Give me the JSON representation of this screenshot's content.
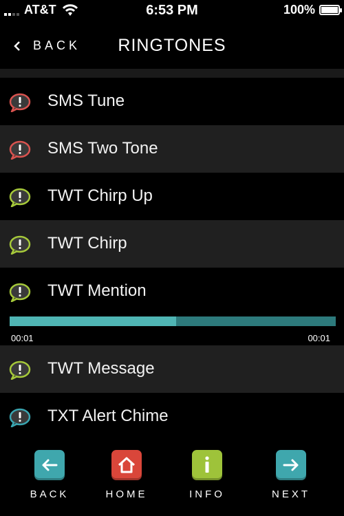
{
  "status_bar": {
    "carrier": "AT&T",
    "time": "6:53 PM",
    "battery": "100%"
  },
  "nav": {
    "back_label": "BACK",
    "title": "RINGTONES"
  },
  "ringtones": [
    {
      "label": "SMS Tune",
      "icon": "alert-bubble-icon",
      "color": "#d9534f"
    },
    {
      "label": "SMS Two Tone",
      "icon": "alert-bubble-icon",
      "color": "#d9534f"
    },
    {
      "label": "TWT Chirp Up",
      "icon": "alert-bubble-icon",
      "color": "#a6c93a"
    },
    {
      "label": "TWT Chirp",
      "icon": "alert-bubble-icon",
      "color": "#a6c93a"
    },
    {
      "label": "TWT Mention",
      "icon": "alert-bubble-icon",
      "color": "#a6c93a"
    },
    {
      "label": "TWT Message",
      "icon": "alert-bubble-icon",
      "color": "#a6c93a"
    },
    {
      "label": "TXT Alert Chime",
      "icon": "alert-bubble-icon",
      "color": "#3aa5b0"
    }
  ],
  "player": {
    "elapsed": "00:01",
    "total": "00:01",
    "progress": 0.51
  },
  "toolbar": {
    "back_label": "BACK",
    "home_label": "HOME",
    "info_label": "INFO",
    "next_label": "NEXT"
  },
  "colors": {
    "back_tile": "#3fa7ad",
    "home_tile": "#d9463a",
    "info_tile": "#9ec33a",
    "next_tile": "#3fa7ad"
  }
}
